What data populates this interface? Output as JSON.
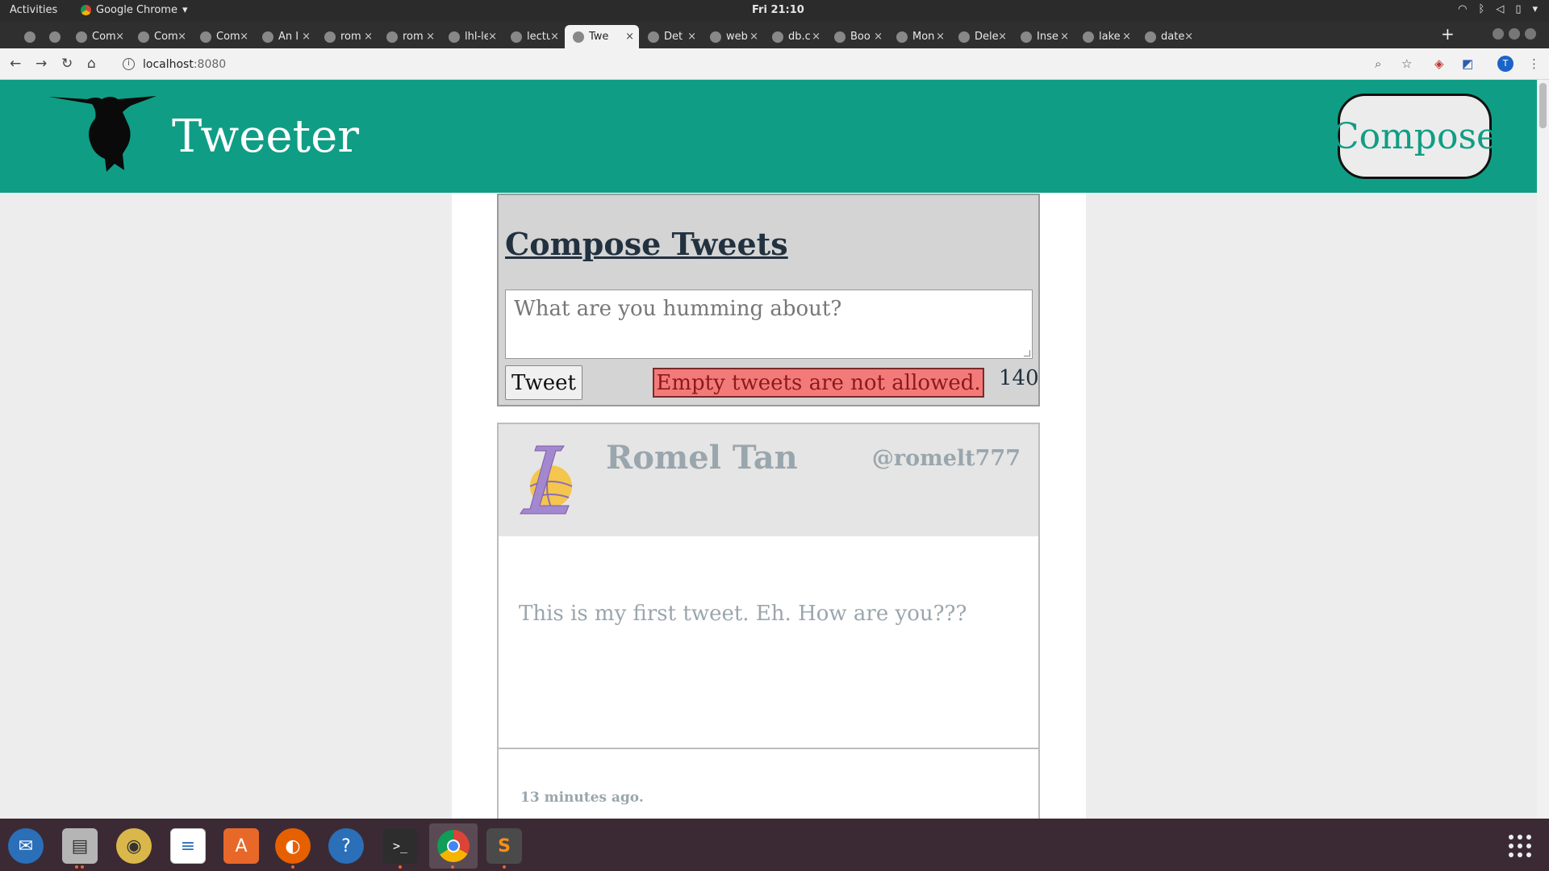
{
  "system_bar": {
    "activities": "Activities",
    "app_name": "Google Chrome",
    "clock": "Fri 21:10"
  },
  "browser": {
    "tabs": [
      {
        "title": "",
        "icon": "circle-icon"
      },
      {
        "title": "",
        "icon": "circle-icon"
      },
      {
        "title": "Com",
        "icon": "circle-icon"
      },
      {
        "title": "Com",
        "icon": "circle-icon"
      },
      {
        "title": "Com",
        "icon": "circle-icon"
      },
      {
        "title": "An I",
        "icon": "s-logo-icon"
      },
      {
        "title": "rom",
        "icon": "github-icon"
      },
      {
        "title": "rom",
        "icon": "github-icon"
      },
      {
        "title": "lhl-le",
        "icon": "github-icon"
      },
      {
        "title": "lectu",
        "icon": "github-icon"
      },
      {
        "title": "Twe",
        "icon": "page-icon",
        "active": true
      },
      {
        "title": "Det",
        "icon": "code-icon"
      },
      {
        "title": "web",
        "icon": "slack-icon"
      },
      {
        "title": "db.c",
        "icon": "mongodb-icon"
      },
      {
        "title": "Boo",
        "icon": "star-icon"
      },
      {
        "title": "Mon",
        "icon": "stackoverflow-icon"
      },
      {
        "title": "Dele",
        "icon": "mongodb-icon"
      },
      {
        "title": "Inse",
        "icon": "mongodb-icon"
      },
      {
        "title": "lake",
        "icon": "google-icon"
      },
      {
        "title": "date",
        "icon": "google-icon"
      }
    ],
    "url": {
      "host": "localhost",
      "port": ":8080"
    },
    "profile_initial": "T"
  },
  "header": {
    "brand": "Tweeter",
    "compose_button": "Compose"
  },
  "composer": {
    "heading": "Compose Tweets",
    "placeholder": "What are you humming about?",
    "submit_label": "Tweet",
    "error_message": "Empty tweets are not allowed.",
    "char_counter": "140"
  },
  "tweets": [
    {
      "name": "Romel Tan",
      "handle": "@romelt777",
      "content": "This is my first tweet. Eh. How are you???",
      "time_ago": "13 minutes ago."
    }
  ],
  "colors": {
    "nav": "#0f9e85",
    "error": "#f47a7a",
    "heading": "#22313f",
    "muted": "#9aa6ad"
  }
}
